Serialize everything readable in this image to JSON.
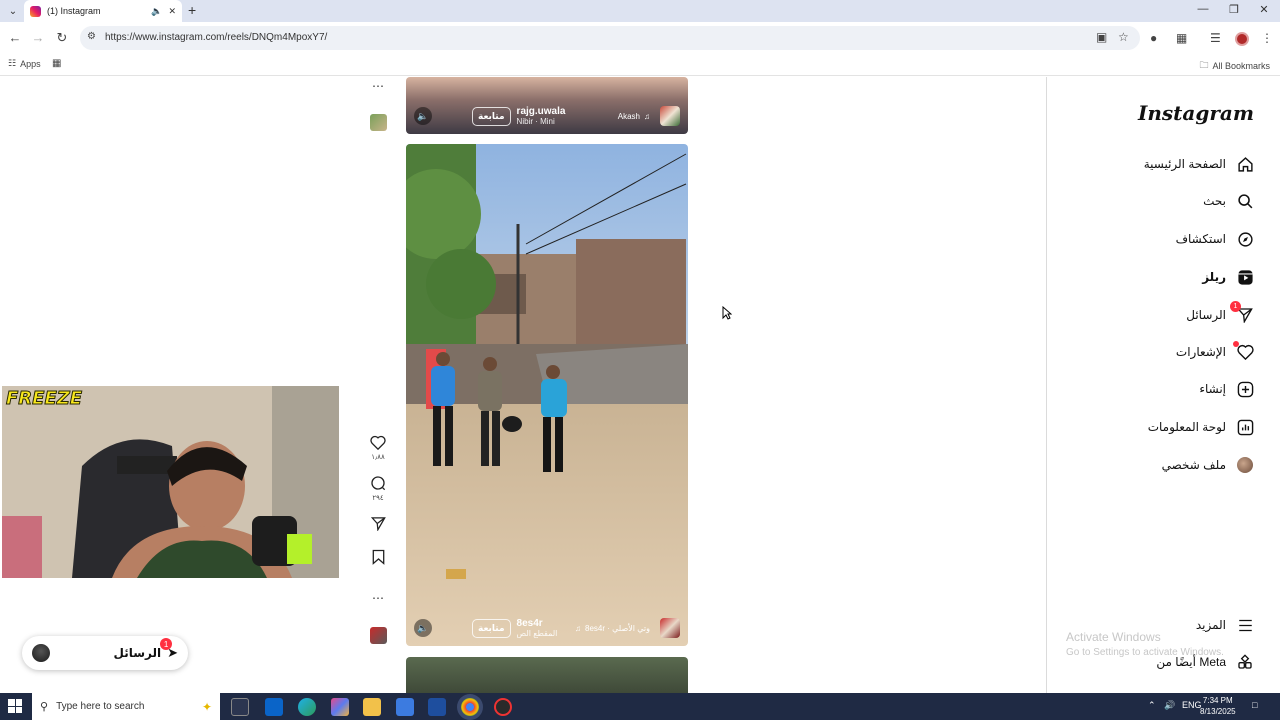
{
  "browser": {
    "tab_title": "(1) Instagram",
    "url": "https://www.instagram.com/reels/DNQm4MpoxY7/",
    "bookmarks": {
      "apps_label": "Apps",
      "all_bookmarks_label": "All Bookmarks"
    }
  },
  "instagram": {
    "logo": "Instagram",
    "nav": [
      {
        "label": "الصفحة الرئيسية",
        "icon": "home-icon"
      },
      {
        "label": "بحث",
        "icon": "search-icon"
      },
      {
        "label": "استكشاف",
        "icon": "compass-icon"
      },
      {
        "label": "ريلز",
        "icon": "reels-icon"
      },
      {
        "label": "الرسائل",
        "icon": "messenger-icon",
        "badge": "1"
      },
      {
        "label": "الإشعارات",
        "icon": "heart-icon"
      },
      {
        "label": "إنشاء",
        "icon": "plus-square-icon"
      },
      {
        "label": "لوحة المعلومات",
        "icon": "dashboard-icon"
      },
      {
        "label": "ملف شخصي",
        "icon": "profile-avatar"
      }
    ],
    "more_label": "المزيد",
    "meta_label": "أيضًا من Meta",
    "reels": [
      {
        "username": "rajg.uwala",
        "caption": "Nibir · Mini",
        "audio": "Akash",
        "follow_label": "متابعة"
      },
      {
        "username": "8es4r",
        "caption": "المقطع الص",
        "audio": "8es4r · وتي الأصلي",
        "follow_label": "متابعة",
        "likes": "١٫٨٨",
        "comments": "٢٩٤"
      }
    ],
    "messages_pill": {
      "label": "الرسائل",
      "badge": "1"
    }
  },
  "overlay": {
    "webcam_label": "FREEZE",
    "watermark_title": "Activate Windows",
    "watermark_sub": "Go to Settings to activate Windows."
  },
  "taskbar": {
    "search_placeholder": "Type here to search",
    "language": "ENG",
    "time": "7:34 PM",
    "date": "8/13/2025"
  }
}
